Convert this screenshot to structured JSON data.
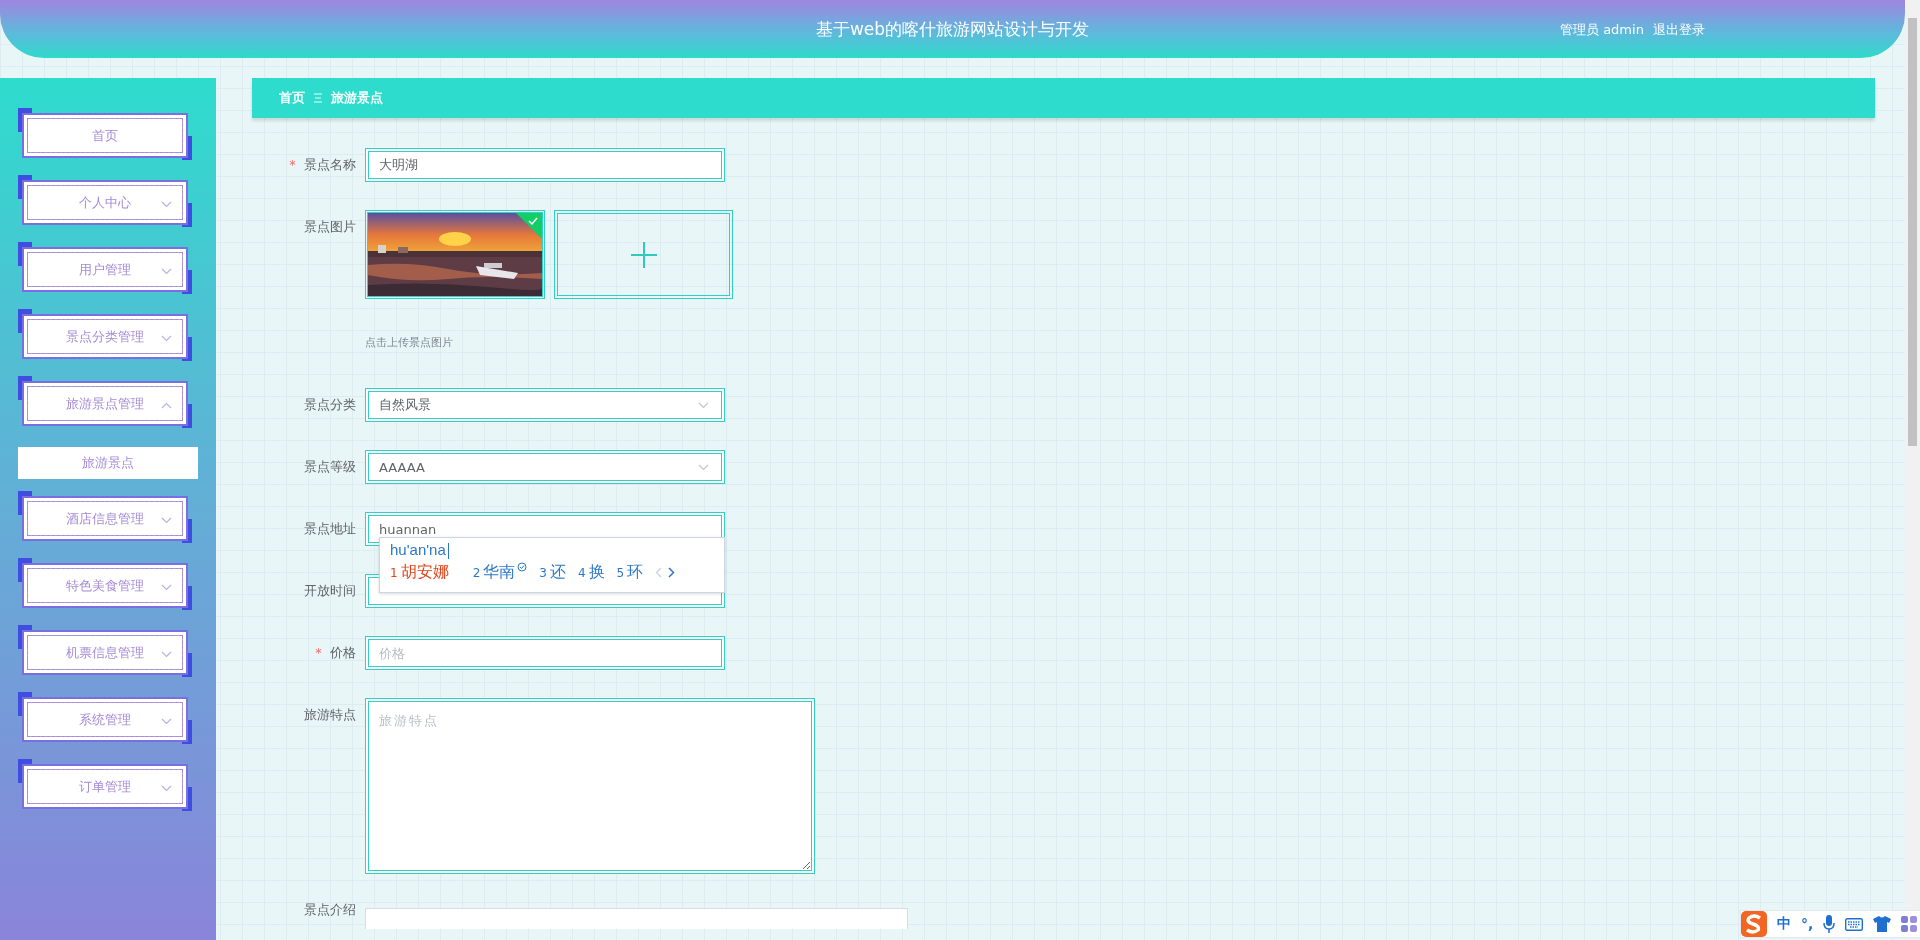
{
  "header": {
    "title": "基于web的喀什旅游网站设计与开发",
    "user": "管理员 admin",
    "logout": "退出登录"
  },
  "sidebar": {
    "items": [
      {
        "label": "首页",
        "kind": "link"
      },
      {
        "label": "个人中心",
        "kind": "menu",
        "expanded": false
      },
      {
        "label": "用户管理",
        "kind": "menu",
        "expanded": false
      },
      {
        "label": "景点分类管理",
        "kind": "menu",
        "expanded": false
      },
      {
        "label": "旅游景点管理",
        "kind": "menu",
        "expanded": true,
        "children": [
          {
            "label": "旅游景点",
            "selected": true
          }
        ]
      },
      {
        "label": "酒店信息管理",
        "kind": "menu",
        "expanded": false
      },
      {
        "label": "特色美食管理",
        "kind": "menu",
        "expanded": false
      },
      {
        "label": "机票信息管理",
        "kind": "menu",
        "expanded": false
      },
      {
        "label": "系统管理",
        "kind": "menu",
        "expanded": false
      },
      {
        "label": "订单管理",
        "kind": "menu",
        "expanded": false
      }
    ]
  },
  "breadcrumb": [
    "首页",
    "旅游景点"
  ],
  "form": {
    "fields": [
      {
        "label": "景点名称",
        "kind": "text",
        "required_mark": "*",
        "value": "大明湖"
      },
      {
        "label": "景点图片",
        "kind": "upload",
        "hint": "点击上传景点图片",
        "images": [
          {
            "kind": "picture",
            "uploaded": true
          }
        ]
      },
      {
        "label": "景点分类",
        "kind": "select",
        "value": "自然风景"
      },
      {
        "label": "景点等级",
        "kind": "select",
        "value": "AAAAA"
      },
      {
        "label": "景点地址",
        "kind": "text",
        "value": "huannan",
        "ime": true
      },
      {
        "label": "开放时间",
        "kind": "text"
      },
      {
        "label": "价格",
        "kind": "text",
        "required_mark": "*",
        "placeholder": "价格"
      },
      {
        "label": "旅游特点",
        "kind": "textarea",
        "placeholder": "旅游特点"
      },
      {
        "label": "景点介绍",
        "kind": "editor"
      }
    ]
  },
  "ime": {
    "composition": "hu'an'na",
    "candidates": [
      {
        "index": "1",
        "text": "胡安娜",
        "selected": true,
        "marked": false
      },
      {
        "index": "2",
        "text": "华南",
        "selected": false,
        "marked": true
      },
      {
        "index": "3",
        "text": "还",
        "selected": false,
        "marked": false
      },
      {
        "index": "4",
        "text": "换",
        "selected": false,
        "marked": false
      },
      {
        "index": "5",
        "text": "环",
        "selected": false,
        "marked": false
      }
    ]
  },
  "ime_toolbar": {
    "mode": "中",
    "punctuation": "°,"
  }
}
